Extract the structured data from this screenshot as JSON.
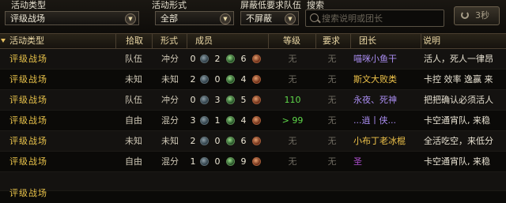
{
  "filters": {
    "activity_type": {
      "label": "活动类型",
      "value": "评级战场"
    },
    "activity_form": {
      "label": "活动形式",
      "value": "全部"
    },
    "shield_low": {
      "label": "屏蔽低要求队伍",
      "value": "不屏蔽"
    },
    "search": {
      "label": "搜索",
      "placeholder": "搜索说明或团长"
    },
    "refresh": {
      "label": "3秒"
    }
  },
  "columns": [
    "活动类型",
    "拾取",
    "形式",
    "成员",
    "等级",
    "要求",
    "团长",
    "说明"
  ],
  "rows": [
    {
      "type": "评级战场",
      "pick": "队伍",
      "form": "冲分",
      "tank": "0",
      "heal": "2",
      "dps": "6",
      "level": "无",
      "req": "无",
      "leader": "喵咪小鱼干",
      "leader_color": "#a98cf0",
      "desc": "活人，死人一律昂"
    },
    {
      "type": "评级战场",
      "pick": "未知",
      "form": "未知",
      "tank": "2",
      "heal": "0",
      "dps": "4",
      "level": "无",
      "req": "无",
      "leader": "斯文大败类",
      "leader_color": "#f0c44a",
      "desc": "卡控 效率 逸赢 来"
    },
    {
      "type": "评级战场",
      "pick": "队伍",
      "form": "冲分",
      "tank": "0",
      "heal": "3",
      "dps": "5",
      "level": "110",
      "req": "无",
      "leader": "永夜、死神",
      "leader_color": "#a98cf0",
      "desc": "把把确认必须活人"
    },
    {
      "type": "评级战场",
      "pick": "自由",
      "form": "混分",
      "tank": "3",
      "heal": "1",
      "dps": "4",
      "level": "> 99",
      "req": "无",
      "leader": "...逍丨侠...",
      "leader_color": "#a98cf0",
      "desc": "卡空通宵队, 来稳"
    },
    {
      "type": "评级战场",
      "pick": "未知",
      "form": "未知",
      "tank": "2",
      "heal": "0",
      "dps": "6",
      "level": "无",
      "req": "无",
      "leader": "小布丁老冰棍",
      "leader_color": "#f0c44a",
      "desc": "全活吃空，来低分"
    },
    {
      "type": "评级战场",
      "pick": "自由",
      "form": "混分",
      "tank": "1",
      "heal": "0",
      "dps": "9",
      "level": "无",
      "req": "无",
      "leader": "圣",
      "leader_color": "#b050d0",
      "desc": "卡空通宵队, 来稳"
    }
  ]
}
